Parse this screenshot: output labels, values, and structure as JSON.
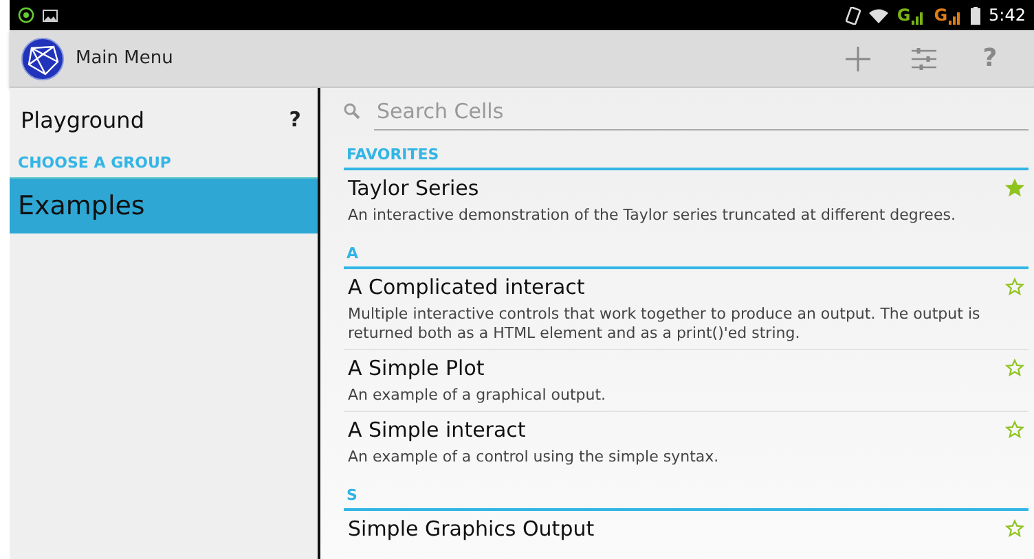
{
  "status_bar": {
    "networks": [
      {
        "label": "G",
        "color": "#7ab317"
      },
      {
        "label": "G",
        "color": "#e07b16"
      }
    ],
    "time": "5:42"
  },
  "action_bar": {
    "title": "Main Menu",
    "actions": [
      {
        "kind": "add"
      },
      {
        "kind": "settings"
      },
      {
        "kind": "help",
        "label": "?"
      }
    ]
  },
  "sidebar": {
    "playground": {
      "label": "Playground",
      "help": "?"
    },
    "group_heading": "CHOOSE A GROUP",
    "groups": [
      {
        "label": "Examples",
        "selected": true
      }
    ]
  },
  "search": {
    "placeholder": "Search Cells"
  },
  "sections": [
    {
      "heading": "FAVORITES",
      "cells": [
        {
          "title": "Taylor Series",
          "description": "An interactive demonstration of the Taylor series truncated at different degrees.",
          "favorite": true
        }
      ]
    },
    {
      "heading": "A",
      "cells": [
        {
          "title": "A Complicated interact",
          "description": "Multiple interactive controls that work together to produce an output. The output is returned both as a HTML element and as a print()'ed string.",
          "favorite": false
        },
        {
          "title": "A Simple Plot",
          "description": "An example of a graphical output.",
          "favorite": false
        },
        {
          "title": "A Simple interact",
          "description": "An example of a control using the simple syntax.",
          "favorite": false
        }
      ]
    },
    {
      "heading": "S",
      "cells": [
        {
          "title": "Simple Graphics Output",
          "favorite": false
        }
      ]
    }
  ]
}
